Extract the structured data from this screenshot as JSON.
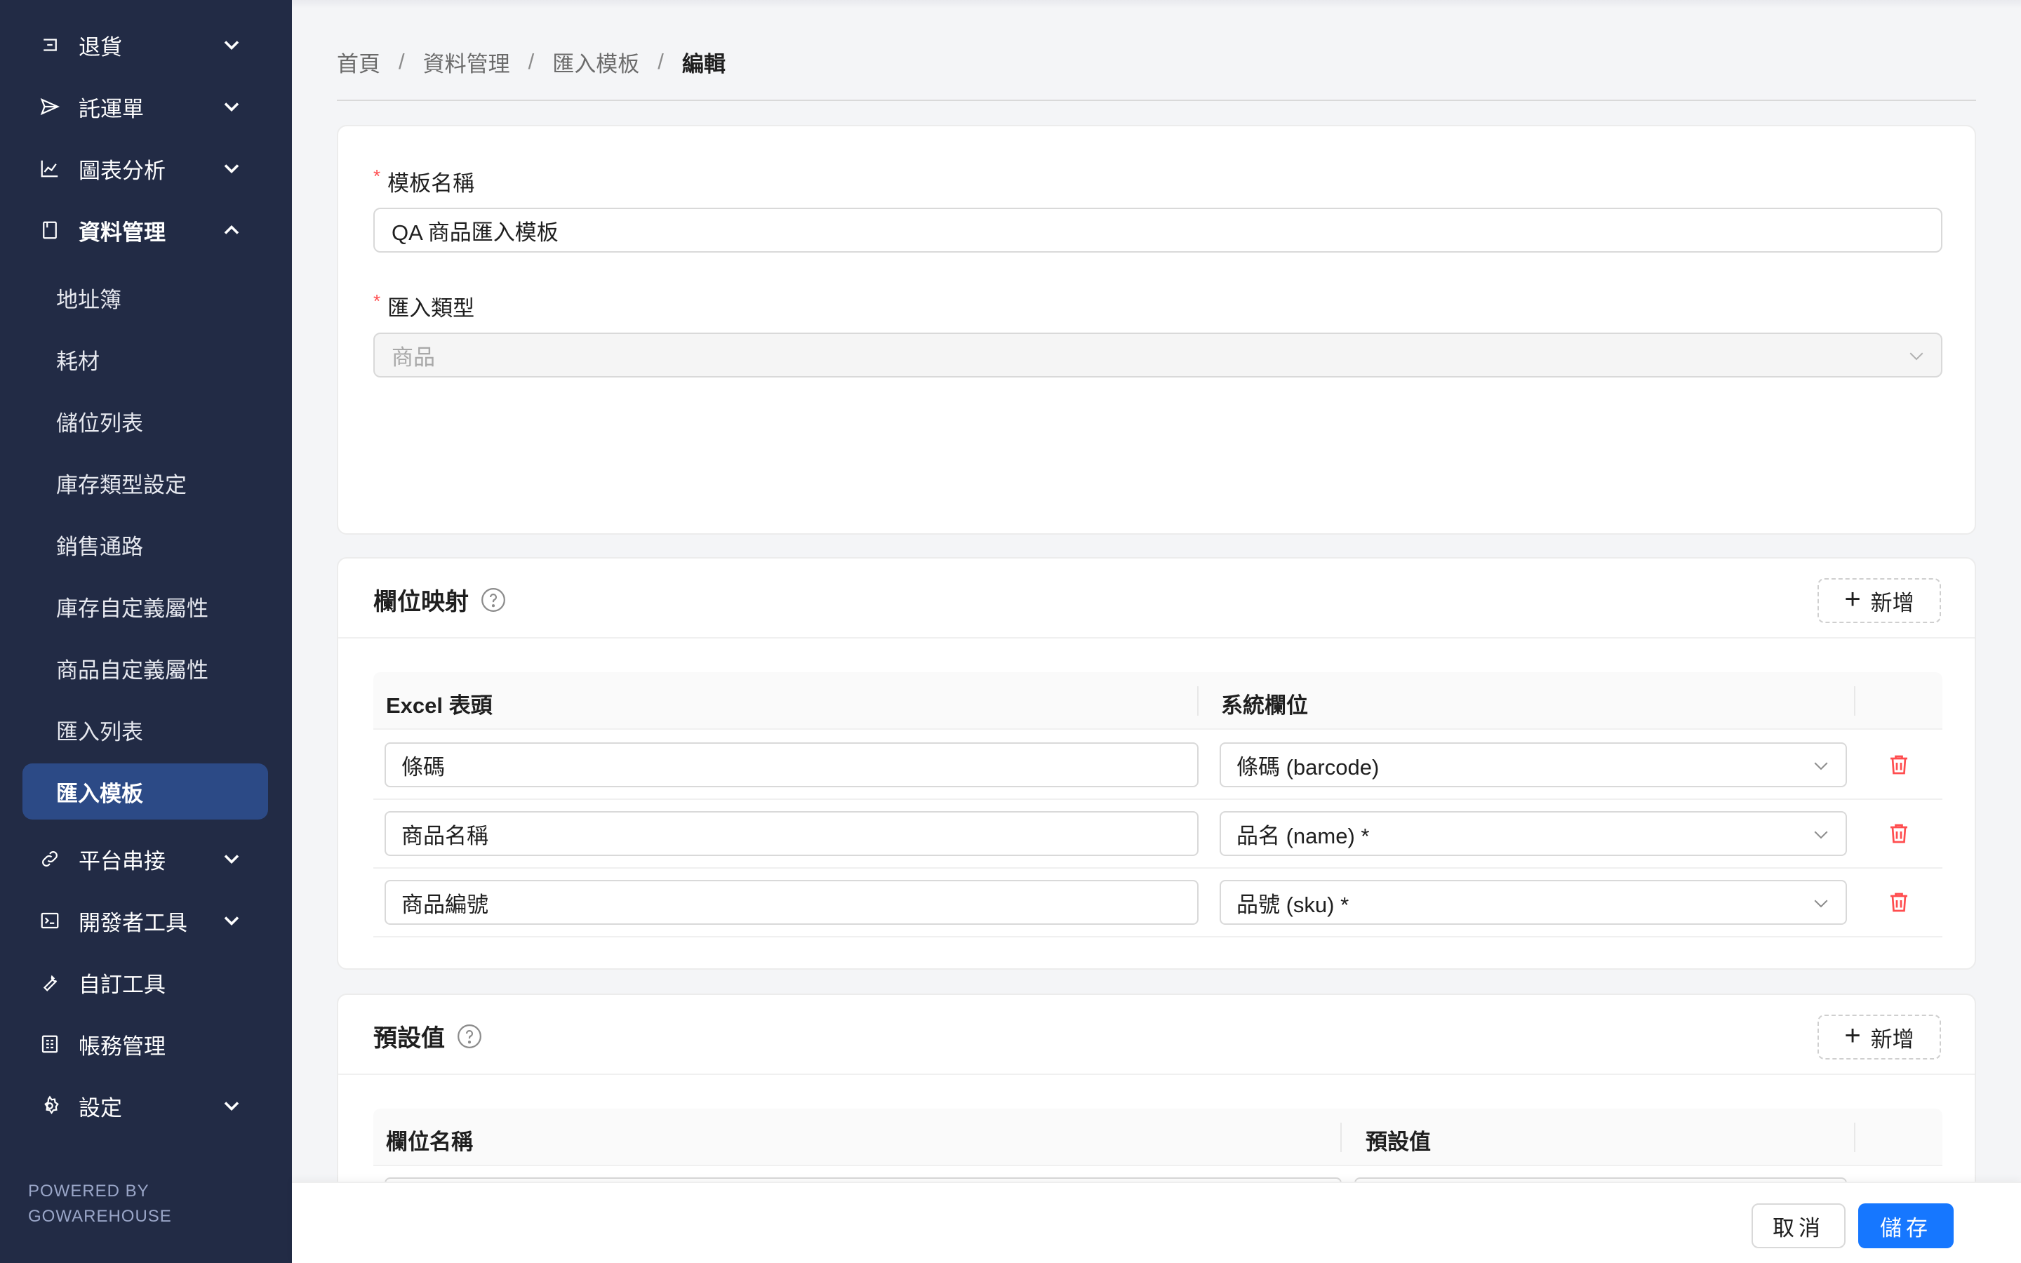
{
  "sidebar": {
    "items": [
      {
        "label": "退貨",
        "icon": "return-icon"
      },
      {
        "label": "託運單",
        "icon": "send-icon"
      },
      {
        "label": "圖表分析",
        "icon": "chart-icon"
      },
      {
        "label": "資料管理",
        "icon": "document-icon"
      }
    ],
    "sub_items": [
      {
        "label": "地址簿"
      },
      {
        "label": "耗材"
      },
      {
        "label": "儲位列表"
      },
      {
        "label": "庫存類型設定"
      },
      {
        "label": "銷售通路"
      },
      {
        "label": "庫存自定義屬性"
      },
      {
        "label": "商品自定義屬性"
      },
      {
        "label": "匯入列表"
      },
      {
        "label": "匯入模板",
        "active": true
      }
    ],
    "bottom_items": [
      {
        "label": "平台串接",
        "icon": "link-icon"
      },
      {
        "label": "開發者工具",
        "icon": "terminal-icon"
      },
      {
        "label": "自訂工具",
        "icon": "wrench-icon"
      },
      {
        "label": "帳務管理",
        "icon": "calculator-icon"
      },
      {
        "label": "設定",
        "icon": "gear-icon"
      }
    ],
    "powered_line1": "POWERED BY",
    "powered_line2": "GOWAREHOUSE"
  },
  "breadcrumb": [
    "首頁",
    "資料管理",
    "匯入模板",
    "編輯"
  ],
  "form": {
    "name_label": "模板名稱",
    "name_value": "QA 商品匯入模板",
    "type_label": "匯入類型",
    "type_value": "商品",
    "required_mark": "*"
  },
  "mapping": {
    "title": "欄位映射",
    "add_label": "新增",
    "col_excel": "Excel 表頭",
    "col_system": "系統欄位",
    "rows": [
      {
        "excel": "條碼",
        "system": "條碼 (barcode)"
      },
      {
        "excel": "商品名稱",
        "system": "品名 (name) *"
      },
      {
        "excel": "商品編號",
        "system": "品號 (sku) *"
      }
    ]
  },
  "defaults": {
    "title": "預設值",
    "add_label": "新增",
    "col_field": "欄位名稱",
    "col_value": "預設值"
  },
  "footer": {
    "cancel_label": "取消",
    "save_label": "儲存"
  },
  "colors": {
    "sidebar_bg": "#222b45",
    "active_item": "#2c4a86",
    "primary": "#1677ff",
    "danger": "#ff4d4f"
  }
}
